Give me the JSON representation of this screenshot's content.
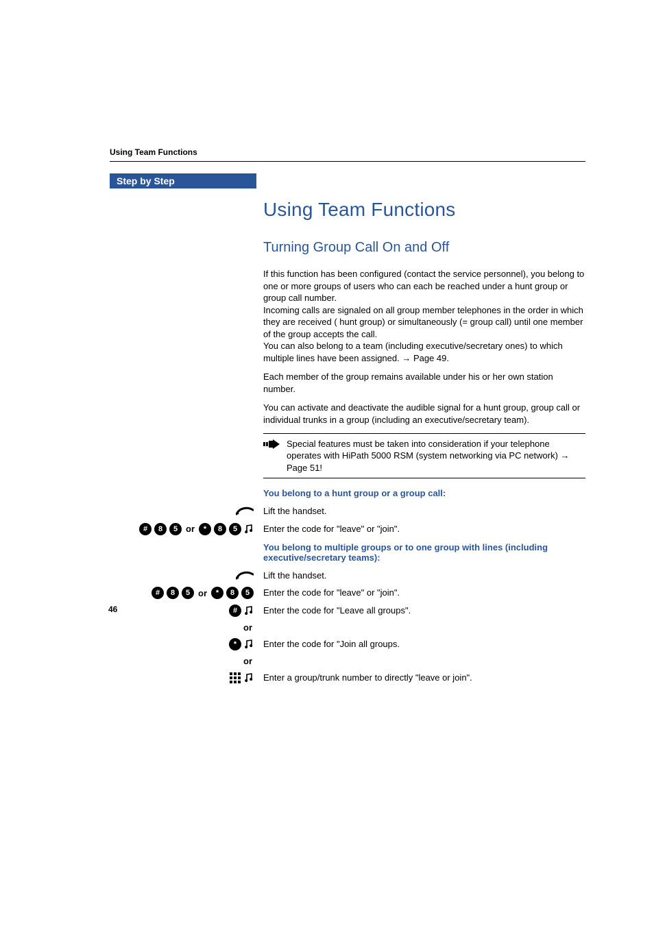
{
  "runningHead": "Using Team Functions",
  "stepBar": "Step by Step",
  "h1": "Using Team Functions",
  "h2": "Turning Group Call On and Off",
  "para1": "If this function has been configured (contact the service personnel), you belong to one or more groups of users who can each be reached under a hunt group or group call number.\nIncoming calls are signaled on all group member telephones in the order in which they are received ( hunt group) or simultaneously (= group call) until one member of the group accepts the call.\nYou can also belong to a team (including executive/secretary ones) to which multiple lines have been assigned. → Page 49.",
  "para2": "Each member of the group remains available under his or her own station number.",
  "para3": "You can activate and deactivate the audible signal for a hunt group, group call or individual trunks in a group (including an executive/secretary team).",
  "note": "Special features must be taken into consideration if your telephone operates with HiPath 5000 RSM (system networking via PC network) → Page 51!",
  "subA": "You belong to a hunt group or a group call:",
  "stepA1": "Lift the handset.",
  "stepA2": "Enter the code for \"leave\" or \"join\".",
  "subB": "You belong to multiple groups or to one group with lines (including executive/secretary teams):",
  "stepB1": "Lift the handset.",
  "stepB2": "Enter the code for \"leave\" or \"join\".",
  "stepB3": "Enter the code for \"Leave all groups\".",
  "stepB4": "Enter the code for \"Join all groups.",
  "stepB5": "Enter a group/trunk number to directly \"leave or join\".",
  "orWord": "or",
  "key8": "8",
  "key5": "5",
  "keyHash": "#",
  "keyStar": "*",
  "pageNum": "46"
}
